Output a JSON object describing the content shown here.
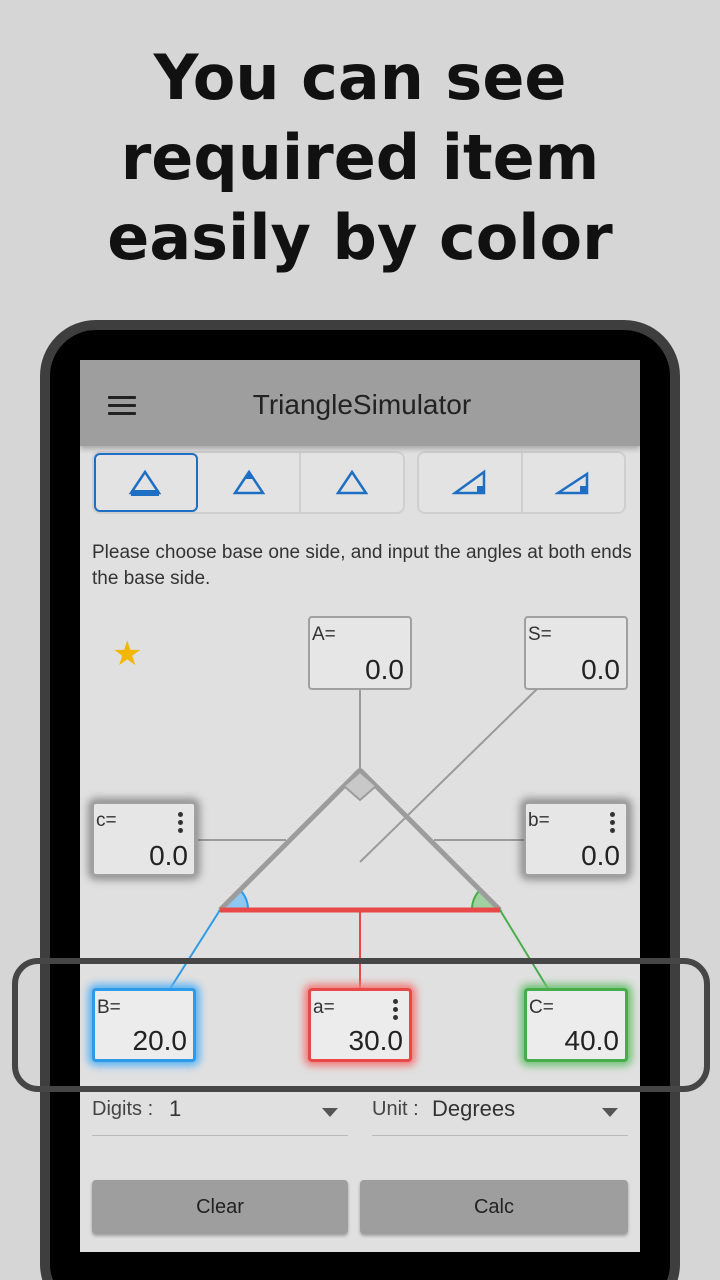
{
  "headline": {
    "line1": "You can see",
    "line2": "required item",
    "line3": "easily by color"
  },
  "app": {
    "title": "TriangleSimulator",
    "menu_icon": "hamburger-menu-icon"
  },
  "mode_tabs": [
    {
      "icon": "triangle-base-bottom-icon",
      "active": true
    },
    {
      "icon": "triangle-apex-icon",
      "active": false
    },
    {
      "icon": "triangle-outline-icon",
      "active": false
    },
    {
      "icon": "right-triangle-icon",
      "active": false
    },
    {
      "icon": "right-triangle-obtuse-icon",
      "active": false
    }
  ],
  "instruction": "Please choose base one side, and input the angles at both ends the base side.",
  "boxes": {
    "A": {
      "label": "A=",
      "value": "0.0"
    },
    "S": {
      "label": "S=",
      "value": "0.0"
    },
    "c": {
      "label": "c=",
      "value": "0.0"
    },
    "b": {
      "label": "b=",
      "value": "0.0"
    },
    "B": {
      "label": "B=",
      "value": "20.0"
    },
    "a": {
      "label": "a=",
      "value": "30.0"
    },
    "C": {
      "label": "C=",
      "value": "40.0"
    }
  },
  "settings": {
    "digits_label": "Digits :",
    "digits_value": "1",
    "unit_label": "Unit :",
    "unit_value": "Degrees"
  },
  "buttons": {
    "clear": "Clear",
    "calc": "Calc"
  },
  "colors": {
    "angle_B": "#2f9ae8",
    "side_a": "#e84848",
    "angle_C": "#45ad4a",
    "star": "#f2b705"
  }
}
